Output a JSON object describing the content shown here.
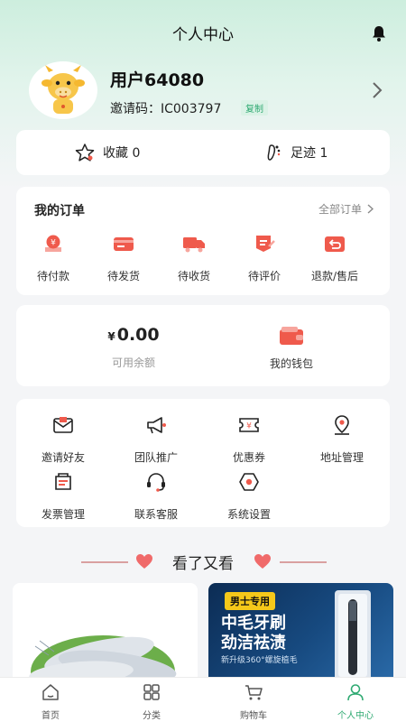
{
  "header": {
    "title": "个人中心",
    "bell_icon": "bell-icon"
  },
  "profile": {
    "username": "用户64080",
    "invite_code": "邀请码：IC003797",
    "copy_label": "复制"
  },
  "favorites": [
    {
      "label": "收藏 0",
      "icon": "star-icon"
    },
    {
      "label": "足迹 1",
      "icon": "footprint-icon"
    }
  ],
  "orders": {
    "title": "我的订单",
    "all_label": "全部订单",
    "items": [
      {
        "label": "待付款",
        "icon": "pending-payment-icon"
      },
      {
        "label": "待发货",
        "icon": "pending-shipment-icon"
      },
      {
        "label": "待收货",
        "icon": "truck-icon"
      },
      {
        "label": "待评价",
        "icon": "review-icon"
      },
      {
        "label": "退款/售后",
        "icon": "refund-icon"
      }
    ]
  },
  "wallet": {
    "currency": "¥",
    "balance": "0.00",
    "balance_label": "可用余额",
    "wallet_label": "我的钱包"
  },
  "tools": [
    {
      "label": "邀请好友",
      "icon": "invite-envelope-icon"
    },
    {
      "label": "团队推广",
      "icon": "megaphone-icon"
    },
    {
      "label": "优惠券",
      "icon": "coupon-icon"
    },
    {
      "label": "地址管理",
      "icon": "location-pin-icon"
    },
    {
      "label": "发票管理",
      "icon": "invoice-icon"
    },
    {
      "label": "联系客服",
      "icon": "headset-icon"
    },
    {
      "label": "系统设置",
      "icon": "settings-icon"
    }
  ],
  "recommend": {
    "title": "看了又看",
    "product2": {
      "badge": "男士专用",
      "headline1": "中毛牙刷",
      "headline2": "劲洁祛渍",
      "subline": "新升级360°螺旋植毛"
    }
  },
  "tabbar": [
    {
      "label": "首页",
      "icon": "home-icon",
      "active": false
    },
    {
      "label": "分类",
      "icon": "grid-icon",
      "active": false
    },
    {
      "label": "购物车",
      "icon": "cart-icon",
      "active": false
    },
    {
      "label": "个人中心",
      "icon": "person-icon",
      "active": true
    }
  ],
  "colors": {
    "accent": "#2faa72",
    "icon_red": "#ef5a4c",
    "header_bg": "#cdeede"
  }
}
